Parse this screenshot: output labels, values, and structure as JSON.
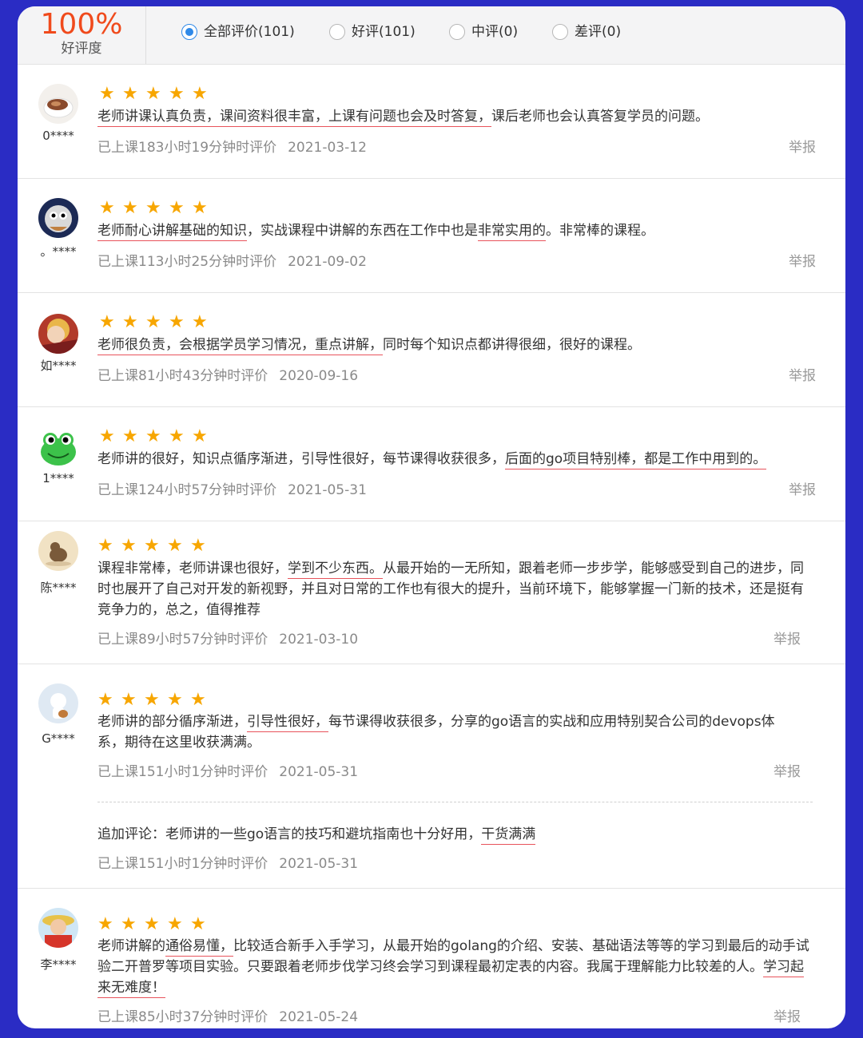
{
  "summary": {
    "percent": "100%",
    "label": "好评度"
  },
  "filters": [
    {
      "label": "全部评价(101)",
      "selected": true
    },
    {
      "label": "好评(101)",
      "selected": false
    },
    {
      "label": "中评(0)",
      "selected": false
    },
    {
      "label": "差评(0)",
      "selected": false
    }
  ],
  "report_label": "举报",
  "reviews": [
    {
      "user": "0****",
      "rating": 5,
      "content": [
        "老师讲课认真负责，课间资料很丰富，上课有问题也会及时答复，",
        "课后老师也会认真答复学员的问题。"
      ],
      "meta": "已上课183小时19分钟时评价",
      "date": "2021-03-12"
    },
    {
      "user": "。****",
      "rating": 5,
      "content": [
        "老师耐心讲解基础的知识",
        "，实战课程中讲解的东西在工作中也是",
        "非常实用的",
        "。非常棒的课程。"
      ],
      "meta": "已上课113小时25分钟时评价",
      "date": "2021-09-02"
    },
    {
      "user": "如****",
      "rating": 5,
      "content": [
        "老师很负责，会根据学员学习情况，重点讲解，",
        "同时每个知识点都讲得很细，很好的课程。"
      ],
      "meta": "已上课81小时43分钟时评价",
      "date": "2020-09-16"
    },
    {
      "user": "1****",
      "rating": 5,
      "content": [
        "老师讲的很好，知识点循序渐进，引导性很好，每节课得收获很多，",
        "后面的go项目特别棒，都是工作中用到的。"
      ],
      "meta": "已上课124小时57分钟时评价",
      "date": "2021-05-31"
    },
    {
      "user": "陈****",
      "rating": 5,
      "content": [
        "课程非常棒，老师讲课也很好，",
        "学到不少东西。",
        "从最开始的一无所知，跟着老师一步步学，能够感受到自己的进步，同时也展开了自己对开发的新视野，并且对日常的工作也有很大的提升，当前环境下，能够掌握一门新的技术，还是挺有竞争力的，总之，值得推荐"
      ],
      "meta": "已上课89小时57分钟时评价",
      "date": "2021-03-10"
    },
    {
      "user": "G****",
      "rating": 5,
      "content": [
        "老师讲的部分循序渐进，",
        "引导性很好，",
        "每节课得收获很多，分享的go语言的实战和应用特别契合公司的devops体系，期待在这里收获满满。"
      ],
      "meta": "已上课151小时1分钟时评价",
      "date": "2021-05-31",
      "followup": {
        "content": [
          "追加评论：老师讲的一些go语言的技巧和避坑指南也十分好用，",
          "干货满满"
        ],
        "meta": "已上课151小时1分钟时评价",
        "date": "2021-05-31"
      }
    },
    {
      "user": "李****",
      "rating": 5,
      "content": [
        "老师讲解的",
        "通俗易懂，",
        "比较适合新手入手学习，从最开始的golang的介绍、安装、基础语法等等的学习到最后的动手试验二开普罗等项目实验。只要跟着老师步伐学习终会学习到课程最初定表的内容。我属于理解能力比较差的人。",
        "学习起来无难度！"
      ],
      "meta": "已上课85小时37分钟时评价",
      "date": "2021-05-24"
    }
  ]
}
